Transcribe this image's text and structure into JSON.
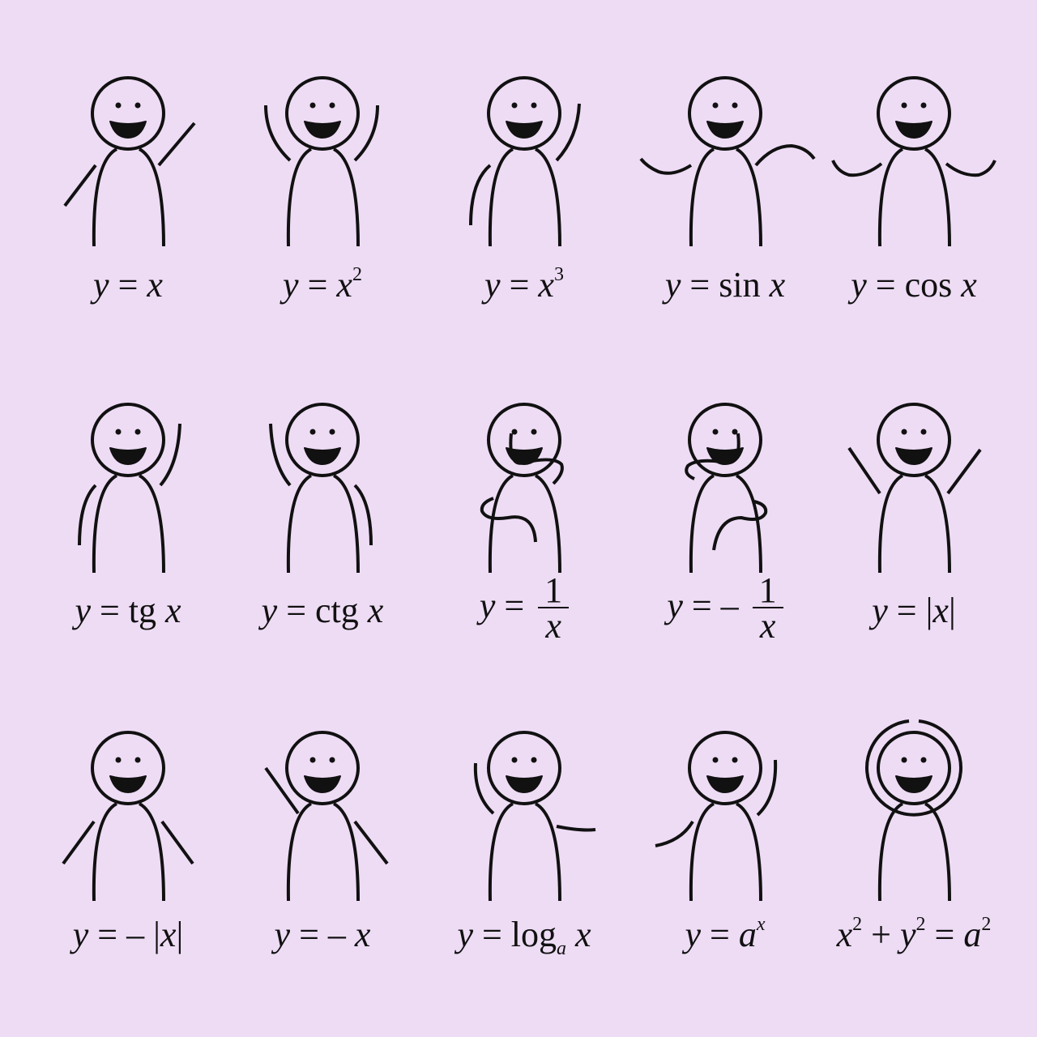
{
  "background": "#eedcf5",
  "stroke_color": "#111111",
  "figures": [
    {
      "id": "y-x",
      "lhs": "y",
      "eq": " = ",
      "rhs": "x"
    },
    {
      "id": "y-x2",
      "lhs": "y",
      "eq": " = ",
      "rhs": "x",
      "sup": "2"
    },
    {
      "id": "y-x3",
      "lhs": "y",
      "eq": " = ",
      "rhs": "x",
      "sup": "3"
    },
    {
      "id": "y-sin",
      "lhs": "y",
      "eq": " = ",
      "func": "sin",
      "rhs": "x"
    },
    {
      "id": "y-cos",
      "lhs": "y",
      "eq": " = ",
      "func": "cos",
      "rhs": "x"
    },
    {
      "id": "y-tg",
      "lhs": "y",
      "eq": " = ",
      "func": "tg",
      "rhs": "x"
    },
    {
      "id": "y-ctg",
      "lhs": "y",
      "eq": " = ",
      "func": "ctg",
      "rhs": "x"
    },
    {
      "id": "y-inv",
      "lhs": "y",
      "eq": " = ",
      "num": "1",
      "den": "x"
    },
    {
      "id": "y-neg-inv",
      "lhs": "y",
      "eq": " = – ",
      "num": "1",
      "den": "x"
    },
    {
      "id": "y-abs",
      "lhs": "y",
      "eq": " = ",
      "rhs_plain": "|",
      "rhs": "x",
      "rhs_plain2": "|"
    },
    {
      "id": "y-neg-abs",
      "lhs": "y",
      "eq": " = – ",
      "rhs_plain": "|",
      "rhs": "x",
      "rhs_plain2": "|"
    },
    {
      "id": "y-neg-x",
      "lhs": "y",
      "eq": " = – ",
      "rhs": "x"
    },
    {
      "id": "y-log",
      "lhs": "y",
      "eq": " = ",
      "func": "log",
      "sub": "a",
      "rhs": "x"
    },
    {
      "id": "y-exp",
      "lhs": "y",
      "eq": " = ",
      "rhs": "a",
      "sup": "x"
    },
    {
      "id": "circle",
      "circle_eq": true,
      "t1": "x",
      "s1": "2",
      "t2": "y",
      "s2": "2",
      "t3": "a",
      "s3": "2",
      "plus": " + ",
      "eq": " = "
    }
  ]
}
